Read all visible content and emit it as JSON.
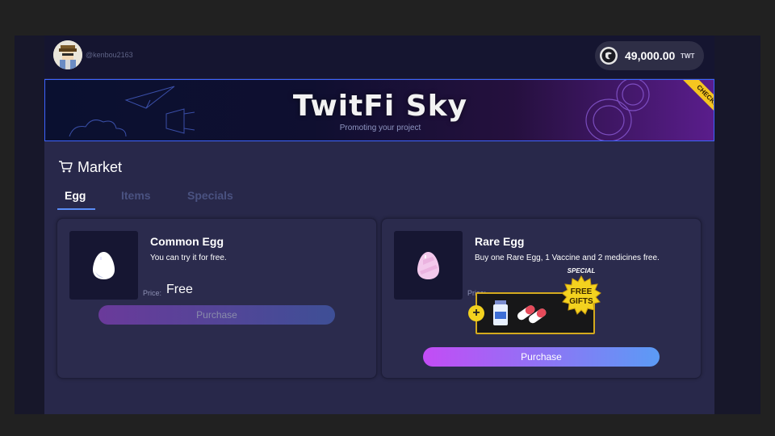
{
  "header": {
    "username": "@kenbou2163",
    "balance_amount": "49,000.00",
    "balance_unit": "TWT"
  },
  "banner": {
    "title": "TwitFi Sky",
    "subtitle": "Promoting your project",
    "ribbon": "CHECK!"
  },
  "market": {
    "title": "Market",
    "tabs": [
      {
        "label": "Egg",
        "active": true
      },
      {
        "label": "Items",
        "active": false
      },
      {
        "label": "Specials",
        "active": false
      }
    ],
    "cards": [
      {
        "title": "Common Egg",
        "description": "You can try it for free.",
        "price_label": "Price:",
        "price_value": "Free",
        "button_label": "Purchase",
        "button_enabled": false,
        "egg_color": "#ffffff"
      },
      {
        "title": "Rare Egg",
        "description": "Buy one Rare Egg, 1 Vaccine and 2 medicines free.",
        "price_label": "Price:",
        "button_label": "Purchase",
        "button_enabled": true,
        "egg_color": "#f3c9ec",
        "promo": {
          "special_label": "SPECIAL",
          "badge_line1": "FREE",
          "badge_line2": "GIFTS"
        }
      }
    ]
  },
  "colors": {
    "accent_start": "#c34cf5",
    "accent_end": "#5b9bf5",
    "badge_gold": "#f3d21f",
    "tab_inactive": "#4a5281"
  }
}
